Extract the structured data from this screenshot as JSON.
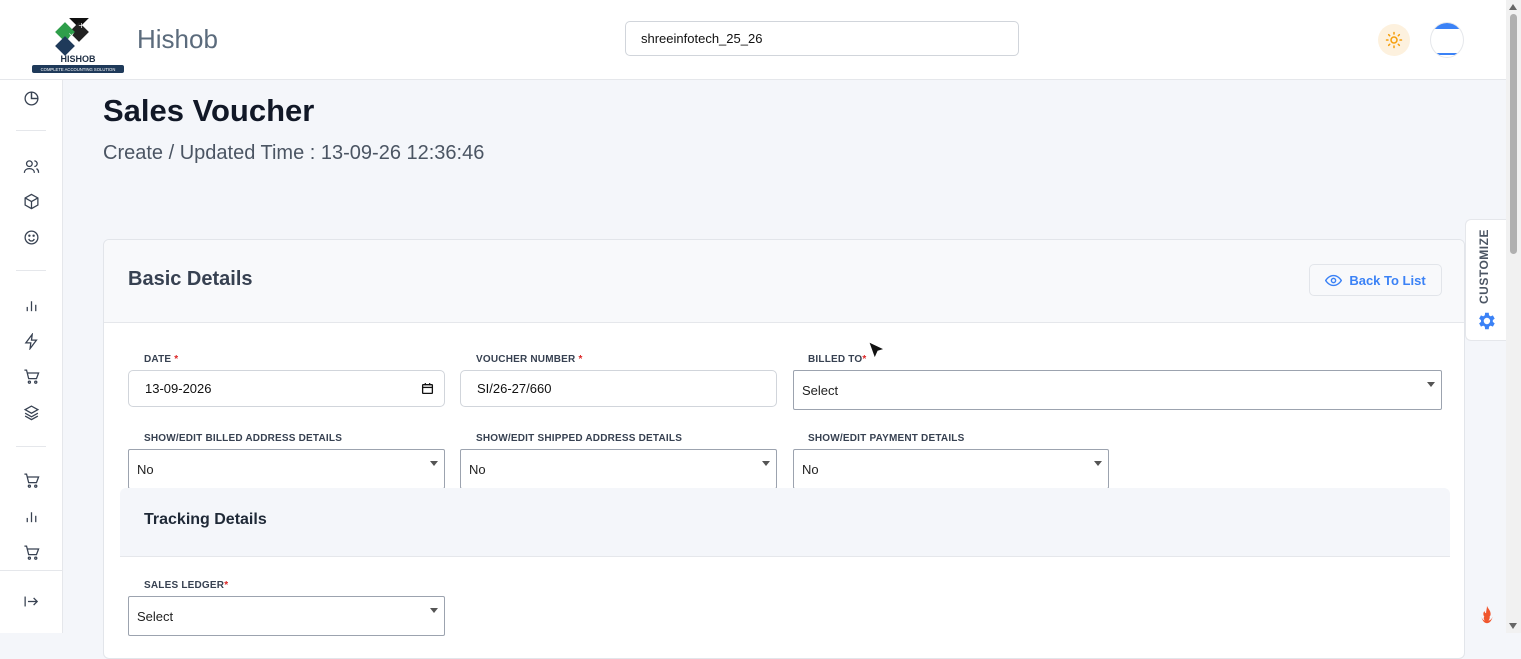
{
  "header": {
    "logo_text": "HISHOB",
    "logo_tagline": "COMPLETE ACCOUNTING SOLUTION",
    "brand": "Hishob",
    "company_value": "shreeinfotech_25_26"
  },
  "sidebar": {
    "icons": [
      "dashboard-icon",
      "users-icon",
      "box-icon",
      "smile-icon",
      "bar-chart-icon",
      "lightning-icon",
      "cart-icon",
      "layers-icon",
      "cart-icon",
      "bar-chart-icon",
      "cart-icon",
      "logout-icon"
    ]
  },
  "page": {
    "title": "Sales Voucher",
    "subtitle": "Create / Updated Time : 13-09-26 12:36:46"
  },
  "basic_details": {
    "title": "Basic Details",
    "back_label": "Back To List",
    "date_label": "DATE",
    "date_value": "13-09-2026",
    "voucher_label": "VOUCHER NUMBER",
    "voucher_value": "SI/26-27/660",
    "billed_label": "BILLED TO",
    "billed_value": "Select",
    "billed_addr_label": "SHOW/EDIT BILLED ADDRESS DETAILS",
    "billed_addr_value": "No",
    "shipped_addr_label": "SHOW/EDIT SHIPPED ADDRESS DETAILS",
    "shipped_addr_value": "No",
    "payment_label": "SHOW/EDIT PAYMENT DETAILS",
    "payment_value": "No",
    "required_mark": "*"
  },
  "tracking": {
    "title": "Tracking Details",
    "sales_ledger_label": "SALES LEDGER",
    "sales_ledger_value": "Select"
  },
  "customize": {
    "label": "CUSTOMIZE"
  },
  "colors": {
    "accent": "#3b82f6",
    "required": "#dc2626",
    "theme_button_bg": "#fdf1de"
  }
}
